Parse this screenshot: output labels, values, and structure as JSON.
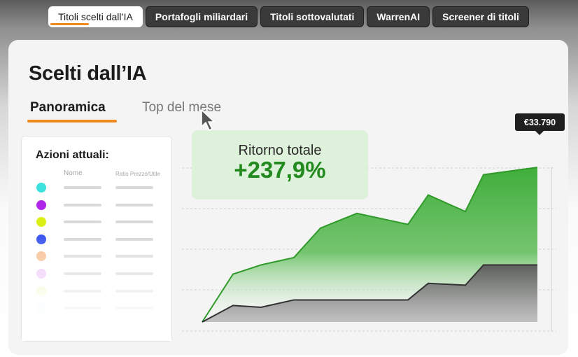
{
  "nav": {
    "tabs": [
      {
        "label": "Titoli scelti dall’IA",
        "active": true
      },
      {
        "label": "Portafogli miliardari",
        "active": false
      },
      {
        "label": "Titoli sottovalutati",
        "active": false
      },
      {
        "label": "WarrenAI",
        "active": false
      },
      {
        "label": "Screener di titoli",
        "active": false
      }
    ]
  },
  "card": {
    "title": "Scelti dall’IA",
    "tabs": {
      "overview": "Panoramica",
      "top_month": "Top del mese"
    }
  },
  "holdings": {
    "title": "Azioni attuali:",
    "columns": {
      "name": "Nome",
      "ratio": "Ratio Prezzo/Utile"
    },
    "rows": [
      {
        "color": "#3be3dc"
      },
      {
        "color": "#b026e8"
      },
      {
        "color": "#dcef12"
      },
      {
        "color": "#3b55ef"
      },
      {
        "color": "#f6be8d"
      },
      {
        "color": "#ecc4f8"
      },
      {
        "color": "#f3fac8"
      },
      {
        "color": "#e6fbfb"
      }
    ]
  },
  "performance": {
    "return_label": "Ritorno totale",
    "return_value": "+237,9%",
    "price_tag": "€33.790"
  },
  "colors": {
    "accent": "#f08a1d",
    "portfolio_green": "#3fae3a",
    "benchmark_gray": "#5a5a5a"
  },
  "chart_data": {
    "type": "area",
    "x": [
      0,
      1,
      2,
      3,
      4,
      5,
      6,
      7,
      8,
      9
    ],
    "series": [
      {
        "values": [
          0,
          26,
          31,
          35,
          51,
          59,
          53,
          69,
          60,
          80,
          84
        ]
      },
      {
        "values": [
          0,
          9,
          8,
          12,
          12,
          12,
          12,
          21,
          20,
          31,
          31
        ]
      }
    ],
    "ylim": [
      0,
      100
    ],
    "grid": true
  }
}
